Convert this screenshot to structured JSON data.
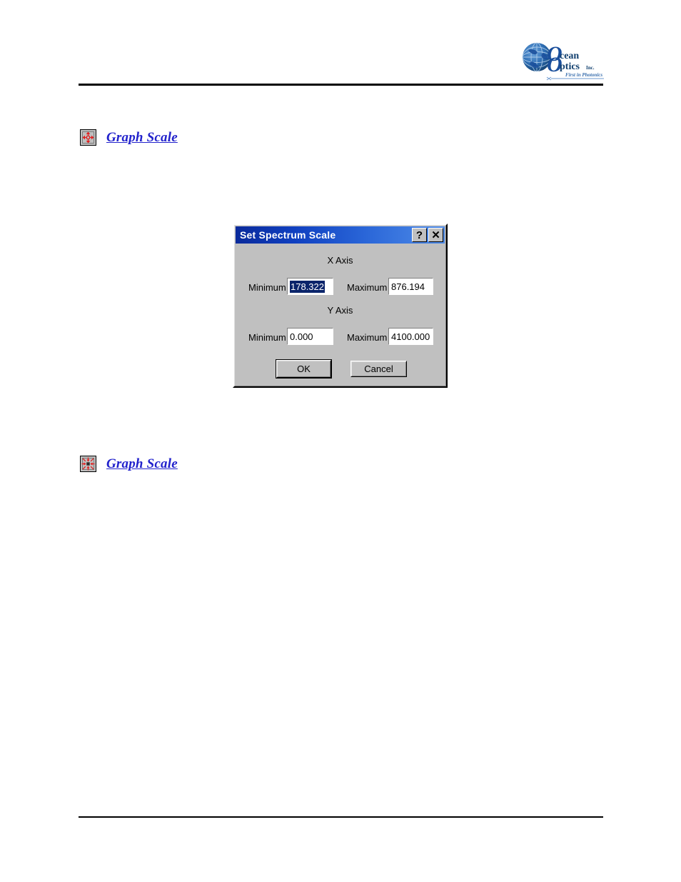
{
  "page": {
    "logo": {
      "name": "ocean-optics-logo",
      "line1": "cean",
      "line2": "ptics",
      "suffix": "Inc.",
      "tagline": "First in Photonics™",
      "brand_color": "#1a4f9c"
    },
    "topics": [
      {
        "icon": "graph-scale-expand-icon",
        "link_label": "Graph Scale",
        "link_color": "#2222cc"
      },
      {
        "icon": "graph-scale-contract-icon",
        "link_label": "Graph Scale",
        "link_color": "#2222cc"
      }
    ]
  },
  "dialog": {
    "title": "Set Spectrum Scale",
    "title_bar_color": "#0a2a9b",
    "help_button_label": "?",
    "close_button_label": "✕",
    "sections": {
      "x_axis": {
        "heading": "X Axis",
        "minimum_label": "Minimum",
        "minimum_value": "178.322",
        "minimum_selected": true,
        "maximum_label": "Maximum",
        "maximum_value": "876.194"
      },
      "y_axis": {
        "heading": "Y Axis",
        "minimum_label": "Minimum",
        "minimum_value": "0.000",
        "maximum_label": "Maximum",
        "maximum_value": "4100.000"
      }
    },
    "buttons": {
      "ok_label": "OK",
      "cancel_label": "Cancel"
    }
  }
}
